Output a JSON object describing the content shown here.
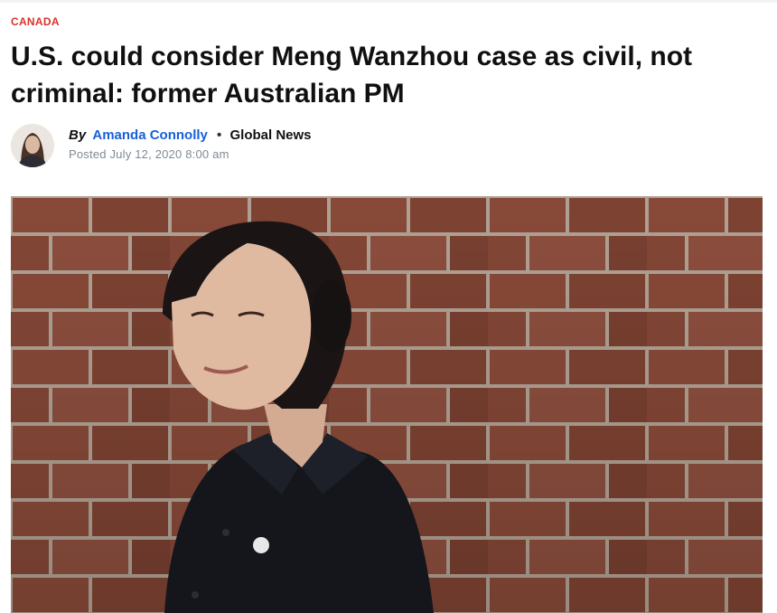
{
  "article": {
    "category": "CANADA",
    "headline": "U.S. could consider Meng Wanzhou case as civil, not criminal: former Australian PM",
    "byline": {
      "by_label": "By",
      "author": "Amanda Connolly",
      "separator": "•",
      "outlet": "Global News",
      "posted": "Posted July 12, 2020 8:00 am"
    },
    "hero_image": {
      "subject": "woman in dark coat in front of brick wall"
    }
  },
  "colors": {
    "category": "#d8322b",
    "author_link": "#1760d8",
    "meta": "#7f8a96",
    "brick": "#8a4b39",
    "mortar": "#b9a99a"
  }
}
